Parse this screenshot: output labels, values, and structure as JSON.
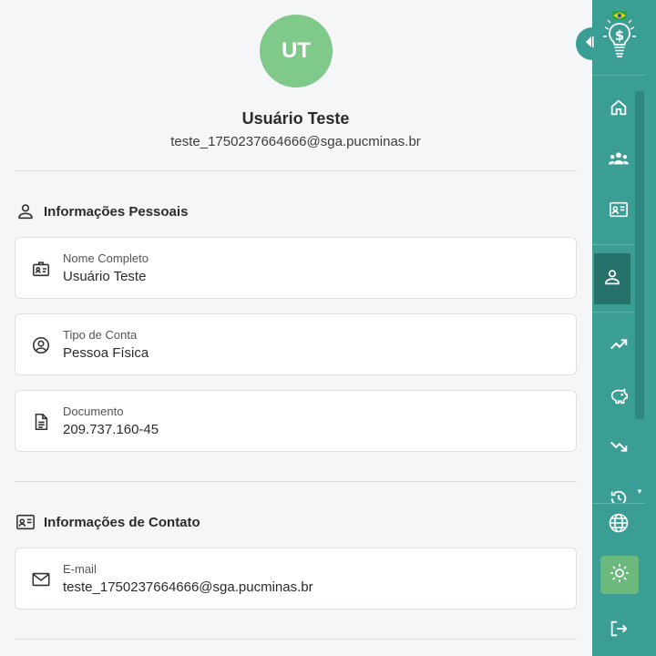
{
  "profile": {
    "initials": "UT",
    "name": "Usuário Teste",
    "email": "teste_1750237664666@sga.pucminas.br"
  },
  "personal": {
    "title": "Informações Pessoais",
    "fields": [
      {
        "label": "Nome Completo",
        "value": "Usuário Teste",
        "icon": "badge-icon"
      },
      {
        "label": "Tipo de Conta",
        "value": "Pessoa Física",
        "icon": "account-circle-icon"
      },
      {
        "label": "Documento",
        "value": "209.737.160-45",
        "icon": "document-icon"
      }
    ]
  },
  "contact": {
    "title": "Informações de Contato",
    "fields": [
      {
        "label": "E-mail",
        "value": "teste_1750237664666@sga.pucminas.br",
        "icon": "mail-icon"
      }
    ]
  },
  "sidebar": {
    "items": [
      {
        "name": "home",
        "icon": "home-icon"
      },
      {
        "name": "groups",
        "icon": "groups-icon"
      },
      {
        "name": "contact-card",
        "icon": "contact-card-icon"
      },
      {
        "name": "profile",
        "icon": "person-icon",
        "active": true
      },
      {
        "name": "trending-up",
        "icon": "trending-up-icon"
      },
      {
        "name": "savings",
        "icon": "piggy-bank-icon"
      },
      {
        "name": "trending-down",
        "icon": "trending-down-icon"
      },
      {
        "name": "history",
        "icon": "history-icon"
      },
      {
        "name": "language",
        "icon": "globe-icon"
      },
      {
        "name": "theme",
        "icon": "sun-icon"
      },
      {
        "name": "logout",
        "icon": "logout-icon"
      }
    ]
  },
  "colors": {
    "sidebar": "#3a9e95",
    "sidebar_active": "#27716b",
    "avatar": "#7fc98a",
    "theme_button": "#6cb97e",
    "background": "#f5f6f8"
  }
}
